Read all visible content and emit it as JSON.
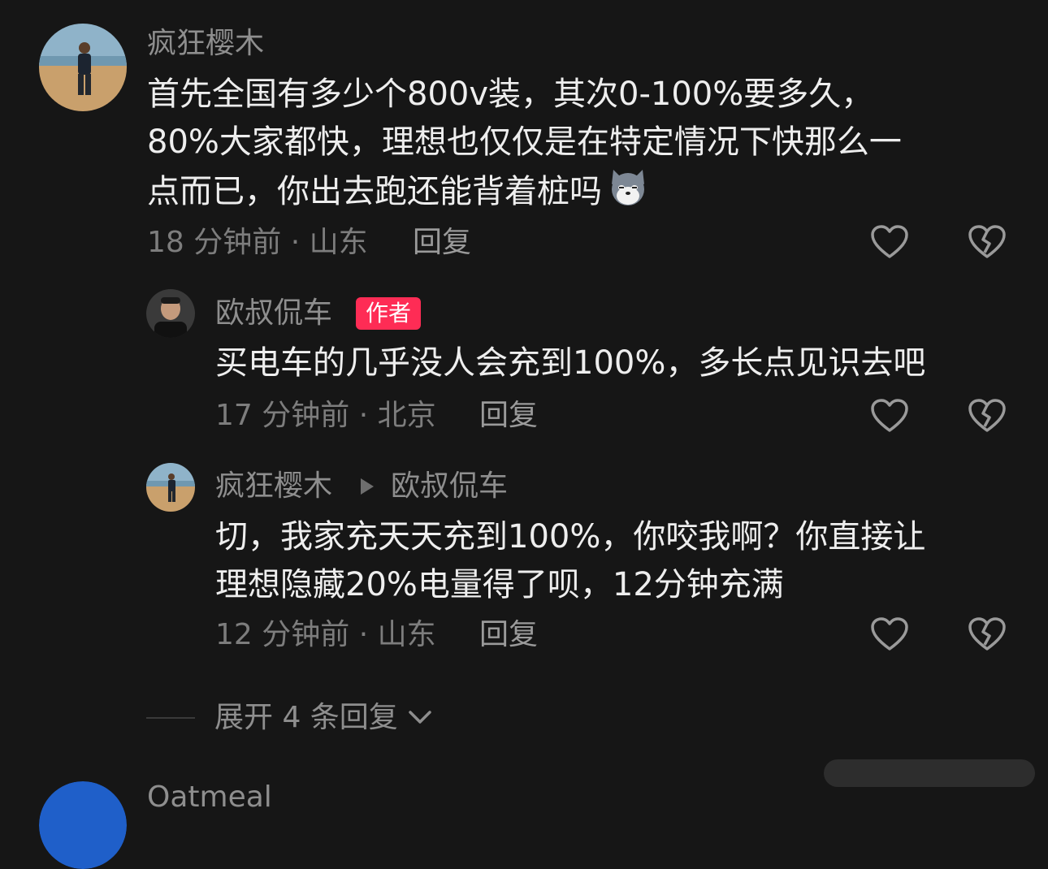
{
  "comments": [
    {
      "username": "疯狂樱木",
      "text": "首先全国有多少个800v装，其次0-100%要多久，\n80%大家都快，理想也仅仅是在特定情况下快那么一\n点而已，你出去跑还能背着桩吗",
      "emoji_icon": "husky-dog-icon",
      "meta": "18 分钟前 · 山东",
      "reply_label": "回复"
    },
    {
      "username": "欧叔侃车",
      "badge": "作者",
      "text": "买电车的几乎没人会充到100%，多长点见识去吧",
      "meta": "17 分钟前 · 北京",
      "reply_label": "回复"
    },
    {
      "username": "疯狂樱木",
      "reply_to": "欧叔侃车",
      "text": "切，我家充天天充到100%，你咬我啊？你直接让\n理想隐藏20%电量得了呗，12分钟充满",
      "meta": "12 分钟前 · 山东",
      "reply_label": "回复"
    }
  ],
  "expand": {
    "label": "展开 4 条回复"
  },
  "next_comment": {
    "username": "Oatmeal"
  },
  "colors": {
    "background": "#161616",
    "badge": "#fe2c55",
    "text": "#eeeeee",
    "muted": "#8e8e8e"
  }
}
